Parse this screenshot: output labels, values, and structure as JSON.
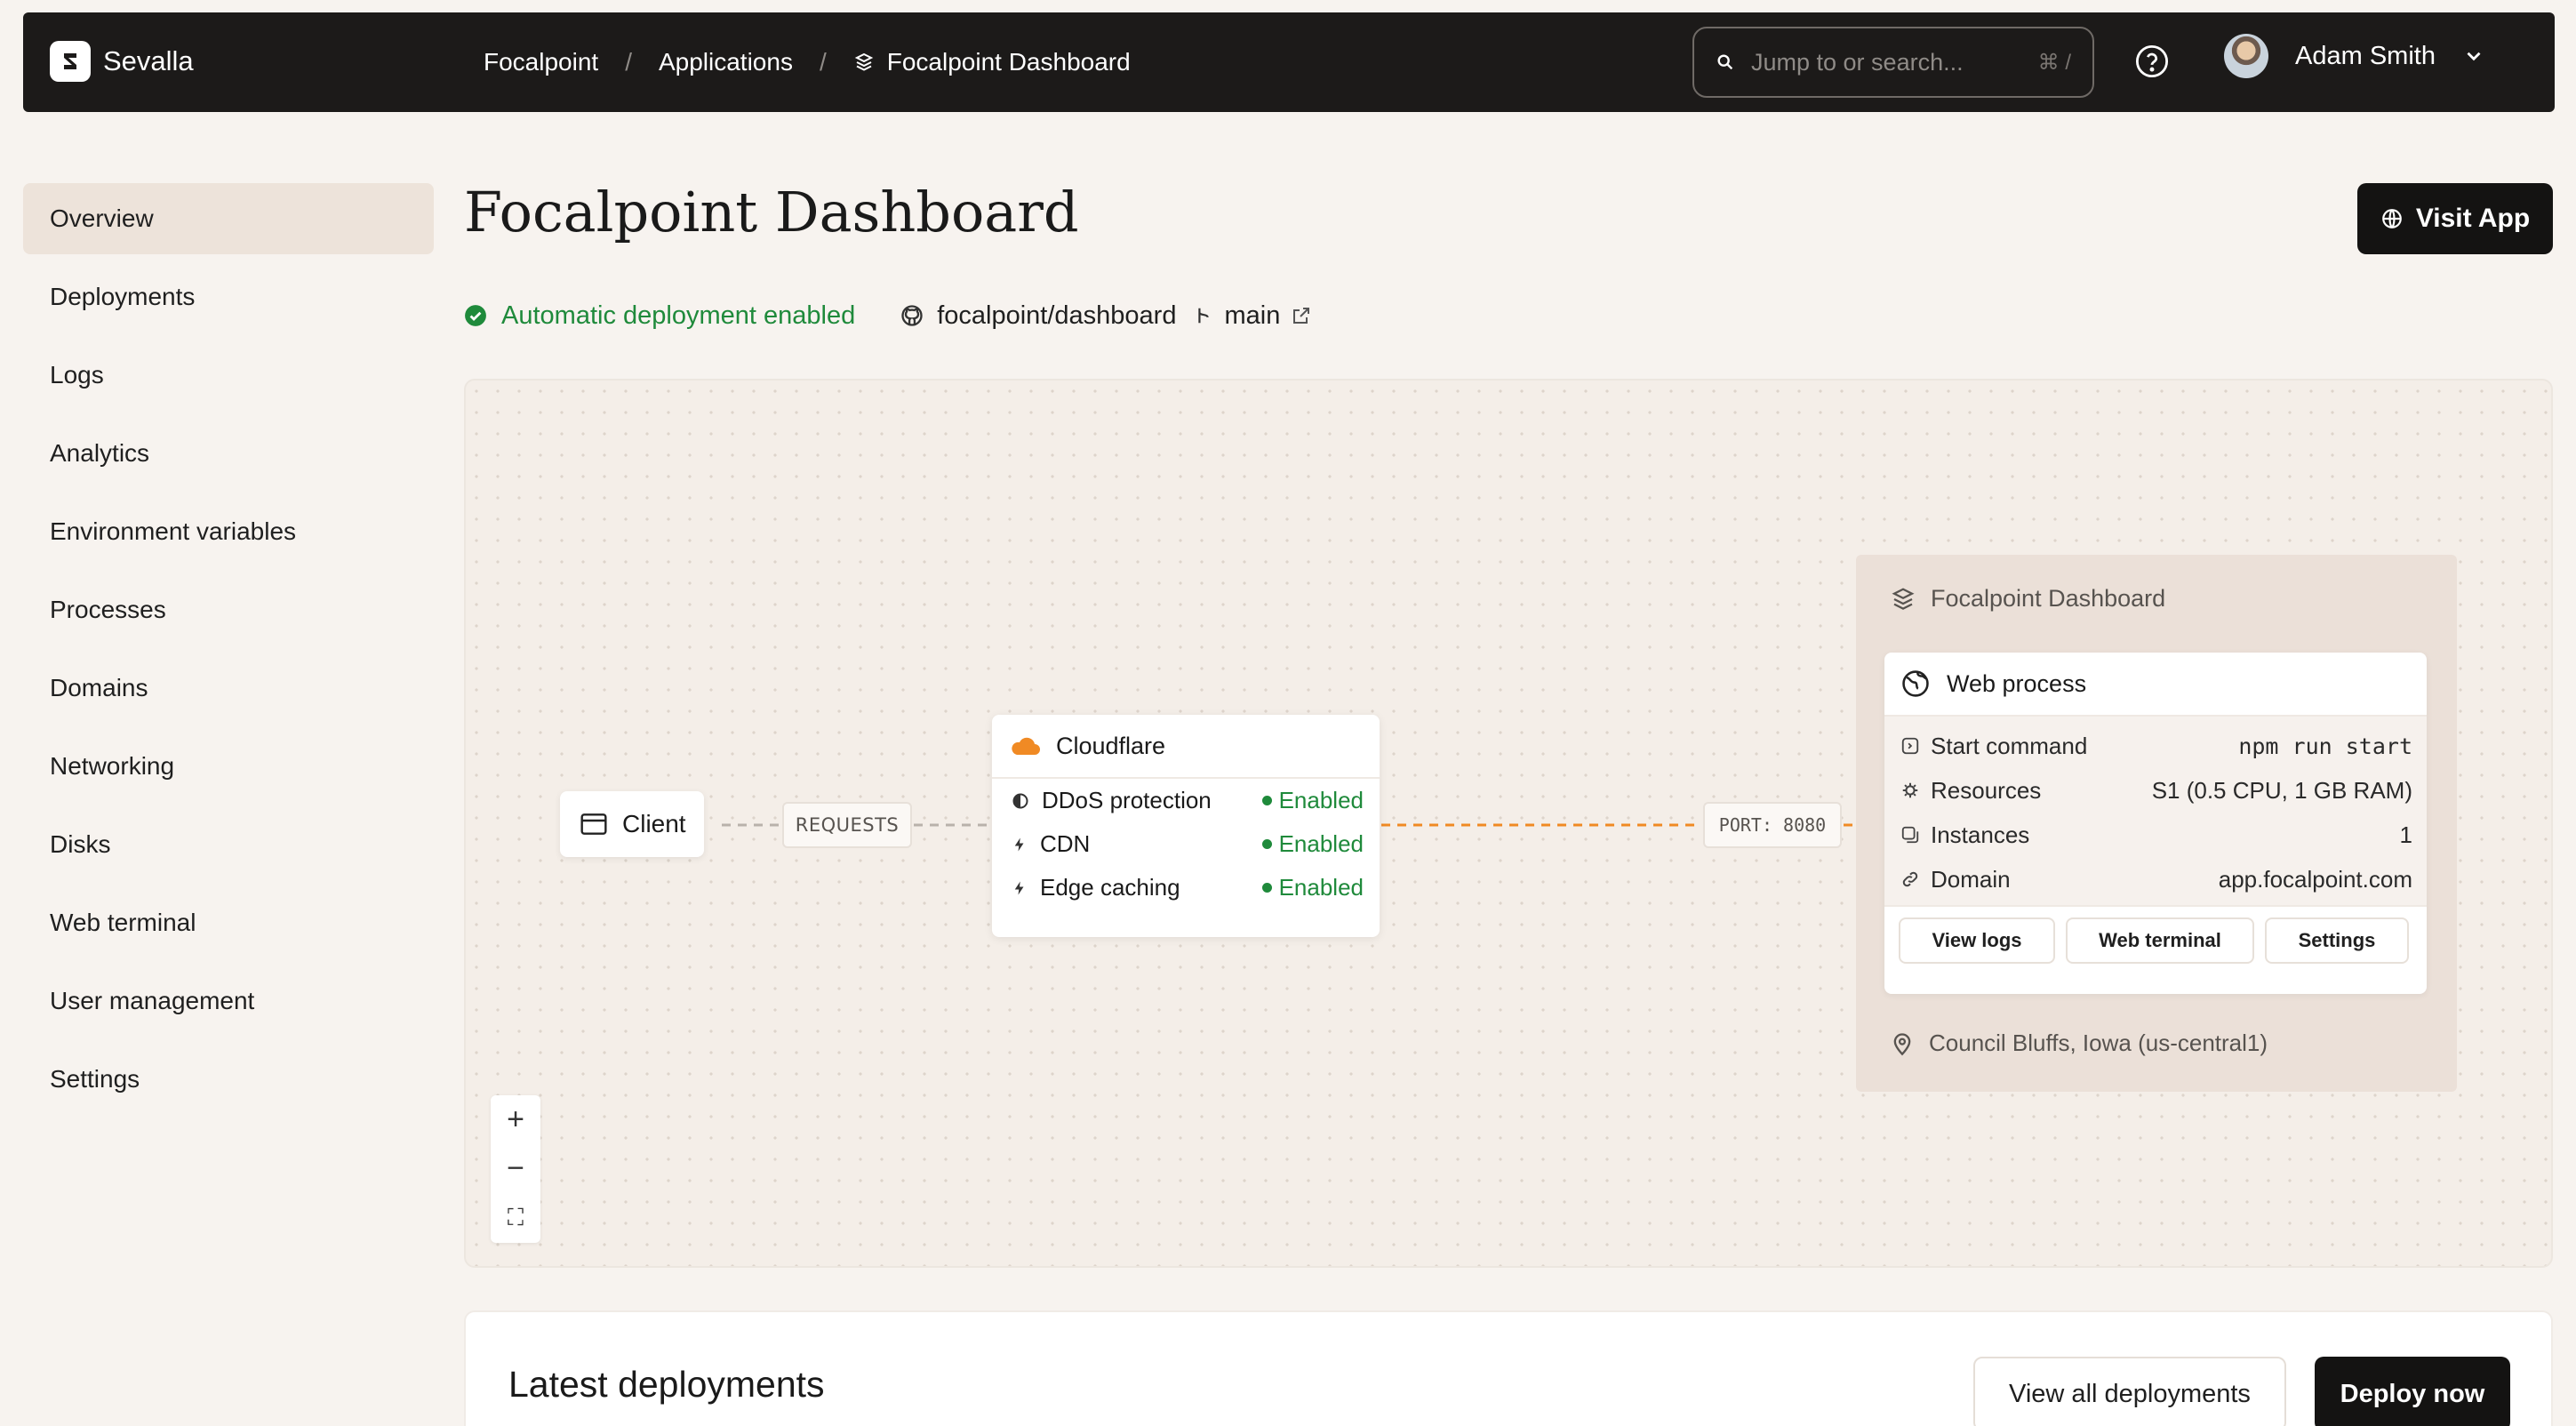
{
  "app": {
    "brand": "Sevalla"
  },
  "breadcrumb": {
    "items": [
      "Focalpoint",
      "Applications",
      "Focalpoint Dashboard"
    ],
    "separator": "/"
  },
  "search": {
    "placeholder": "Jump to or search...",
    "shortcut": "⌘ /"
  },
  "user": {
    "name": "Adam Smith"
  },
  "sidebar": {
    "items": [
      {
        "label": "Overview",
        "active": true
      },
      {
        "label": "Deployments"
      },
      {
        "label": "Logs"
      },
      {
        "label": "Analytics"
      },
      {
        "label": "Environment variables"
      },
      {
        "label": "Processes"
      },
      {
        "label": "Domains"
      },
      {
        "label": "Networking"
      },
      {
        "label": "Disks"
      },
      {
        "label": "Web terminal"
      },
      {
        "label": "User management"
      },
      {
        "label": "Settings"
      }
    ]
  },
  "header": {
    "title": "Focalpoint Dashboard",
    "visit_label": "Visit App",
    "auto_deploy": "Automatic deployment enabled",
    "repo": "focalpoint/dashboard",
    "branch": "main"
  },
  "diagram": {
    "client": "Client",
    "requests": "REQUESTS",
    "port": "PORT: 8080",
    "cloudflare": {
      "title": "Cloudflare",
      "rows": [
        {
          "label": "DDoS protection",
          "status": "Enabled"
        },
        {
          "label": "CDN",
          "status": "Enabled"
        },
        {
          "label": "Edge caching",
          "status": "Enabled"
        }
      ]
    },
    "app": {
      "title": "Focalpoint Dashboard",
      "process_title": "Web process",
      "rows": [
        {
          "label": "Start command",
          "value": "npm run start"
        },
        {
          "label": "Resources",
          "value": "S1 (0.5 CPU, 1 GB RAM)"
        },
        {
          "label": "Instances",
          "value": "1"
        },
        {
          "label": "Domain",
          "value": "app.focalpoint.com"
        }
      ],
      "buttons": [
        "View logs",
        "Web terminal",
        "Settings"
      ],
      "location": "Council Bluffs, Iowa (us-central1)"
    },
    "zoom": [
      "+",
      "−",
      "⛶"
    ]
  },
  "deployments": {
    "title": "Latest deployments",
    "view_all": "View all deployments",
    "deploy_now": "Deploy now"
  },
  "colors": {
    "topbar": "#1c1a19",
    "background": "#f7f3ef",
    "success": "#1f8a3b",
    "accent_orange": "#f08a24",
    "panel": "#ebe0d8"
  }
}
